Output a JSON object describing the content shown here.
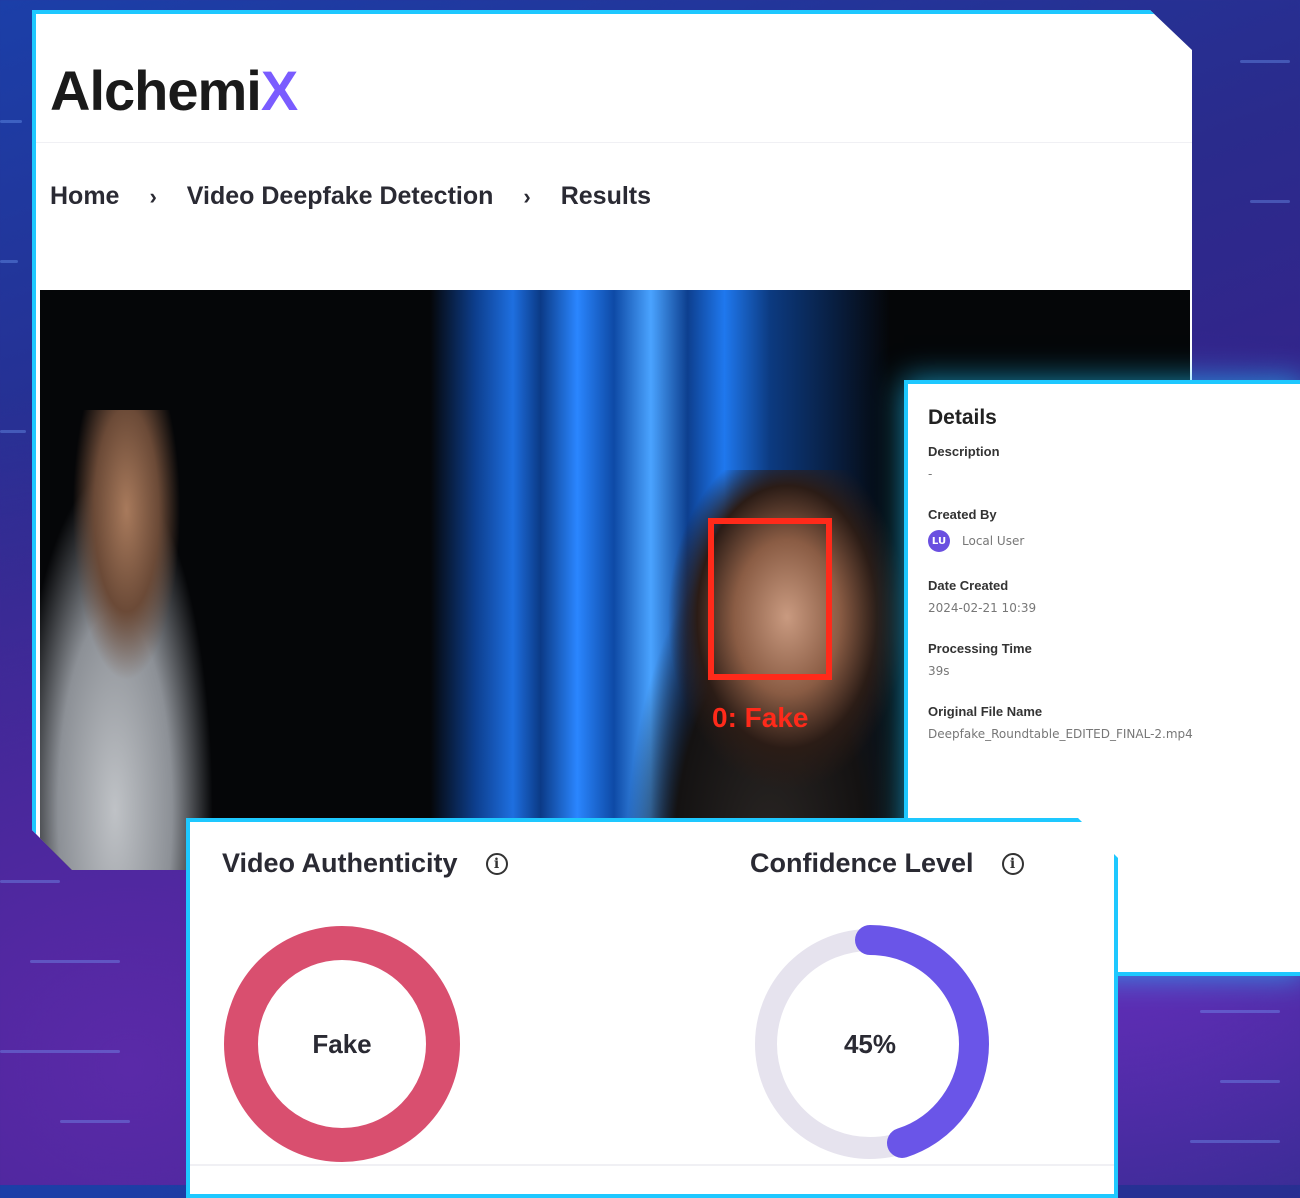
{
  "app": {
    "logo_main": "Alchemi",
    "logo_accent": "X"
  },
  "breadcrumb": {
    "items": [
      "Home",
      "Video Deepfake Detection",
      "Results"
    ],
    "separator": "›"
  },
  "video": {
    "detection_label": "0: Fake"
  },
  "details": {
    "title": "Details",
    "description_label": "Description",
    "description_value": "-",
    "created_by_label": "Created By",
    "created_by_initials": "LU",
    "created_by_value": "Local User",
    "date_created_label": "Date Created",
    "date_created_value": "2024-02-21 10:39",
    "processing_time_label": "Processing Time",
    "processing_time_value": "39s",
    "original_file_label": "Original File Name",
    "original_file_value": "Deepfake_Roundtable_EDITED_FINAL-2.mp4"
  },
  "metrics": {
    "authenticity_title": "Video Authenticity",
    "authenticity_value": "Fake",
    "confidence_title": "Confidence Level",
    "confidence_value": "45%",
    "confidence_fraction": 0.45
  },
  "colors": {
    "accent": "#7a5cff",
    "border_glow": "#1ec8ff",
    "fake": "#d94f6f",
    "confidence": "#6a55e8",
    "confidence_track": "#e6e3ee",
    "detection_box": "#ff2a1a"
  }
}
